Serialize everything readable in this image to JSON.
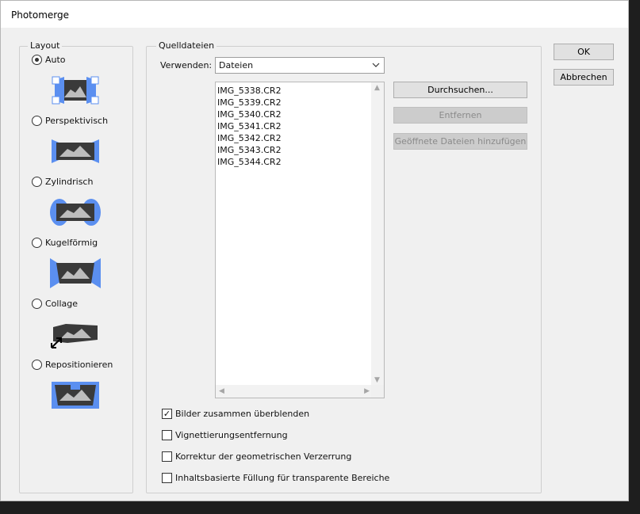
{
  "window": {
    "title": "Photomerge"
  },
  "layout": {
    "label": "Layout",
    "options": [
      {
        "label": "Auto",
        "selected": true
      },
      {
        "label": "Perspektivisch",
        "selected": false
      },
      {
        "label": "Zylindrisch",
        "selected": false
      },
      {
        "label": "Kugelförmig",
        "selected": false
      },
      {
        "label": "Collage",
        "selected": false
      },
      {
        "label": "Repositionieren",
        "selected": false
      }
    ]
  },
  "source": {
    "label": "Quelldateien",
    "use_label": "Verwenden:",
    "use_value": "Dateien",
    "files": [
      "IMG_5338.CR2",
      "IMG_5339.CR2",
      "IMG_5340.CR2",
      "IMG_5341.CR2",
      "IMG_5342.CR2",
      "IMG_5343.CR2",
      "IMG_5344.CR2"
    ],
    "browse_label": "Durchsuchen...",
    "remove_label": "Entfernen",
    "add_open_label": "Geöffnete Dateien hinzufügen",
    "options": [
      {
        "label": "Bilder zusammen überblenden",
        "checked": true
      },
      {
        "label": "Vignettierungsentfernung",
        "checked": false
      },
      {
        "label": "Korrektur der geometrischen Verzerrung",
        "checked": false
      },
      {
        "label": "Inhaltsbasierte Füllung für transparente Bereiche",
        "checked": false
      }
    ]
  },
  "actions": {
    "ok_label": "OK",
    "cancel_label": "Abbrechen"
  },
  "colors": {
    "accent_blue": "#5b8ff0",
    "icon_dark": "#3a3a3a"
  }
}
